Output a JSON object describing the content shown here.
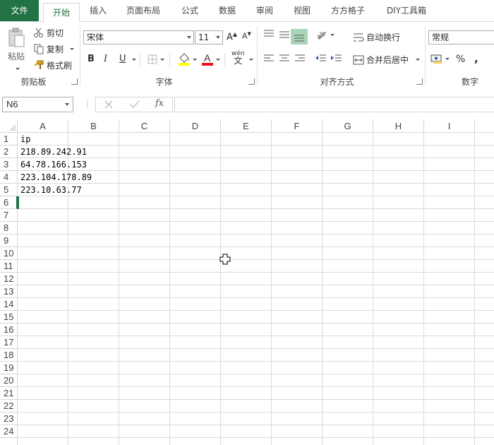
{
  "menubar": {
    "tabs": [
      "文件",
      "开始",
      "插入",
      "页面布局",
      "公式",
      "数据",
      "审阅",
      "视图",
      "方方格子",
      "DIY工具箱"
    ]
  },
  "ribbon": {
    "clipboard": {
      "paste_label": "粘贴",
      "cut_label": "剪切",
      "copy_label": "复制",
      "format_painter_label": "格式刷",
      "group_label": "剪贴板"
    },
    "font": {
      "font_name": "宋体",
      "font_size": "11",
      "bold": "B",
      "italic": "I",
      "underline": "U",
      "group_label": "字体",
      "phonetic_label": "wén"
    },
    "alignment": {
      "wrap_text_label": "自动换行",
      "merge_center_label": "合并后居中",
      "group_label": "对齐方式"
    },
    "number": {
      "format_value": "常规",
      "percent": "%",
      "comma": ",",
      "group_label": "数字"
    }
  },
  "formula_bar": {
    "name_box": "N6",
    "fx": "fx",
    "formula": ""
  },
  "sheet": {
    "columns": [
      "A",
      "B",
      "C",
      "D",
      "E",
      "F",
      "G",
      "H",
      "I"
    ],
    "rows": [
      "1",
      "2",
      "3",
      "4",
      "5",
      "6",
      "7",
      "8",
      "9",
      "10",
      "11",
      "12",
      "13",
      "14",
      "15",
      "16",
      "17",
      "18",
      "19",
      "20",
      "21",
      "22",
      "23",
      "24"
    ],
    "cells": {
      "A1": "ip",
      "A2": "218.89.242.91",
      "A3": "64.78.166.153",
      "A4": "223.104.178.89",
      "A5": "223.10.63.77"
    },
    "active_row": "6"
  },
  "colors": {
    "accent": "#217346",
    "font_color_bar": "#e81123",
    "fill_color_bar": "#ffff00"
  }
}
